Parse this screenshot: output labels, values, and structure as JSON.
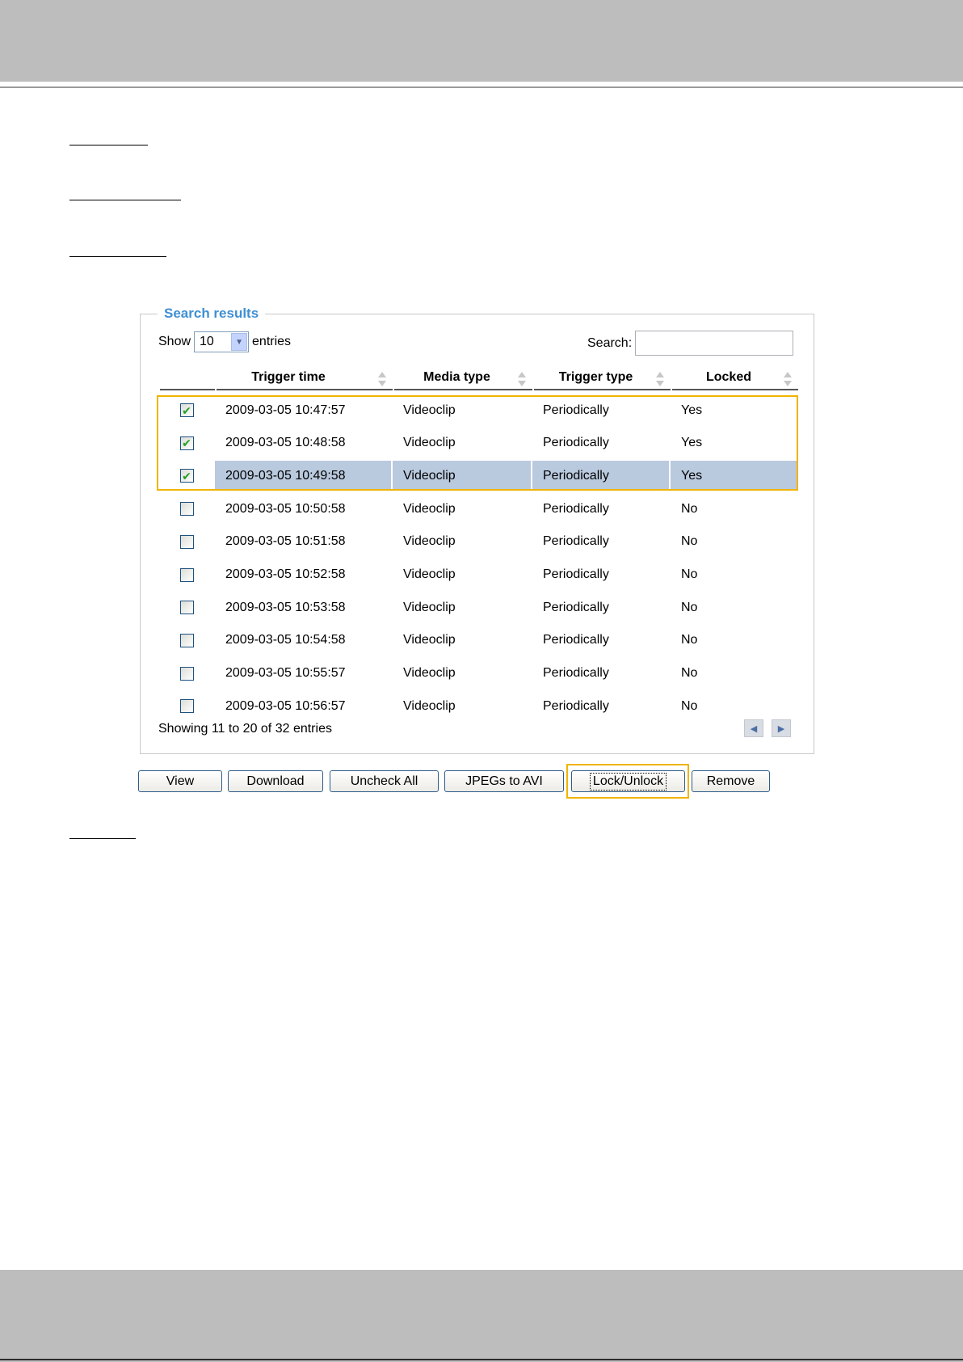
{
  "fieldset": {
    "legend": "Search results"
  },
  "length_menu": {
    "show_label": "Show",
    "value": "10",
    "entries_label": "entries"
  },
  "search": {
    "label": "Search:",
    "value": ""
  },
  "columns": [
    "",
    "Trigger time",
    "Media type",
    "Trigger type",
    "Locked"
  ],
  "rows": [
    {
      "checked": true,
      "trigger_time": "2009-03-05 10:47:57",
      "media_type": "Videoclip",
      "trigger_type": "Periodically",
      "locked": "Yes"
    },
    {
      "checked": true,
      "trigger_time": "2009-03-05 10:48:58",
      "media_type": "Videoclip",
      "trigger_type": "Periodically",
      "locked": "Yes"
    },
    {
      "checked": true,
      "trigger_time": "2009-03-05 10:49:58",
      "media_type": "Videoclip",
      "trigger_type": "Periodically",
      "locked": "Yes"
    },
    {
      "checked": false,
      "trigger_time": "2009-03-05 10:50:58",
      "media_type": "Videoclip",
      "trigger_type": "Periodically",
      "locked": "No"
    },
    {
      "checked": false,
      "trigger_time": "2009-03-05 10:51:58",
      "media_type": "Videoclip",
      "trigger_type": "Periodically",
      "locked": "No"
    },
    {
      "checked": false,
      "trigger_time": "2009-03-05 10:52:58",
      "media_type": "Videoclip",
      "trigger_type": "Periodically",
      "locked": "No"
    },
    {
      "checked": false,
      "trigger_time": "2009-03-05 10:53:58",
      "media_type": "Videoclip",
      "trigger_type": "Periodically",
      "locked": "No"
    },
    {
      "checked": false,
      "trigger_time": "2009-03-05 10:54:58",
      "media_type": "Videoclip",
      "trigger_type": "Periodically",
      "locked": "No"
    },
    {
      "checked": false,
      "trigger_time": "2009-03-05 10:55:57",
      "media_type": "Videoclip",
      "trigger_type": "Periodically",
      "locked": "No"
    },
    {
      "checked": false,
      "trigger_time": "2009-03-05 10:56:57",
      "media_type": "Videoclip",
      "trigger_type": "Periodically",
      "locked": "No"
    }
  ],
  "selected_row": 3,
  "info": "Showing 11 to 20 of 32 entries",
  "pager": {
    "prev_icon": "triangle-left-icon",
    "next_icon": "triangle-right-icon"
  },
  "buttons": {
    "view": "View",
    "download": "Download",
    "uncheck_all": "Uncheck All",
    "jpegs_to_avi": "JPEGs to AVI",
    "lock_unlock": "Lock/Unlock",
    "remove": "Remove"
  },
  "colors": {
    "highlight": "#f0b400",
    "legend": "#3f8fd3",
    "selected_row": "#b9c9de",
    "band": "#bcbdbc"
  }
}
